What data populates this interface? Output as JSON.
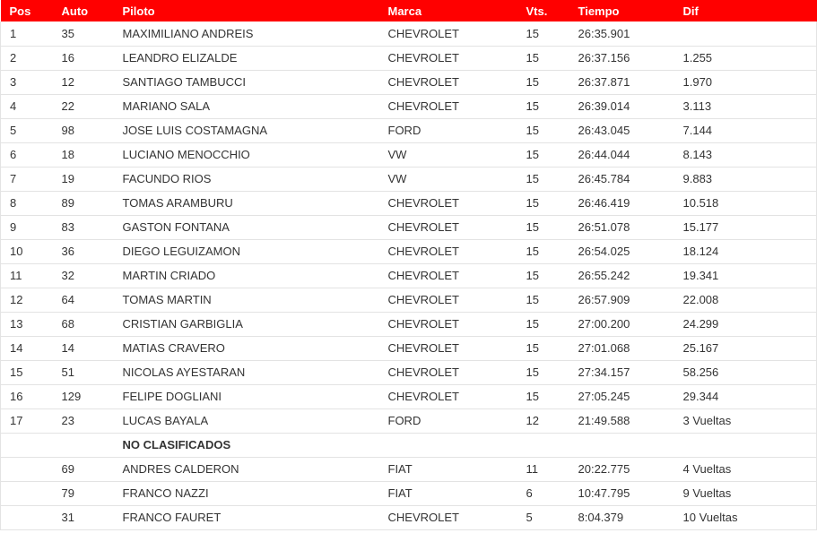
{
  "headers": {
    "pos": "Pos",
    "auto": "Auto",
    "piloto": "Piloto",
    "marca": "Marca",
    "vts": "Vts.",
    "tiempo": "Tiempo",
    "dif": "Dif"
  },
  "colors": {
    "header_bg": "#ff0000",
    "header_text": "#ffffff"
  },
  "classified": [
    {
      "pos": "1",
      "auto": "35",
      "piloto": "MAXIMILIANO ANDREIS",
      "marca": "CHEVROLET",
      "vts": "15",
      "tiempo": "26:35.901",
      "dif": ""
    },
    {
      "pos": "2",
      "auto": "16",
      "piloto": "LEANDRO ELIZALDE",
      "marca": "CHEVROLET",
      "vts": "15",
      "tiempo": "26:37.156",
      "dif": "1.255"
    },
    {
      "pos": "3",
      "auto": "12",
      "piloto": "SANTIAGO TAMBUCCI",
      "marca": "CHEVROLET",
      "vts": "15",
      "tiempo": "26:37.871",
      "dif": "1.970"
    },
    {
      "pos": "4",
      "auto": "22",
      "piloto": "MARIANO SALA",
      "marca": "CHEVROLET",
      "vts": "15",
      "tiempo": "26:39.014",
      "dif": "3.113"
    },
    {
      "pos": "5",
      "auto": "98",
      "piloto": "JOSE LUIS COSTAMAGNA",
      "marca": "FORD",
      "vts": "15",
      "tiempo": "26:43.045",
      "dif": "7.144"
    },
    {
      "pos": "6",
      "auto": "18",
      "piloto": "LUCIANO MENOCCHIO",
      "marca": "VW",
      "vts": "15",
      "tiempo": "26:44.044",
      "dif": "8.143"
    },
    {
      "pos": "7",
      "auto": "19",
      "piloto": "FACUNDO RIOS",
      "marca": "VW",
      "vts": "15",
      "tiempo": "26:45.784",
      "dif": "9.883"
    },
    {
      "pos": "8",
      "auto": "89",
      "piloto": "TOMAS ARAMBURU",
      "marca": "CHEVROLET",
      "vts": "15",
      "tiempo": "26:46.419",
      "dif": "10.518"
    },
    {
      "pos": "9",
      "auto": "83",
      "piloto": "GASTON FONTANA",
      "marca": "CHEVROLET",
      "vts": "15",
      "tiempo": "26:51.078",
      "dif": "15.177"
    },
    {
      "pos": "10",
      "auto": "36",
      "piloto": "DIEGO LEGUIZAMON",
      "marca": "CHEVROLET",
      "vts": "15",
      "tiempo": "26:54.025",
      "dif": "18.124"
    },
    {
      "pos": "11",
      "auto": "32",
      "piloto": "MARTIN CRIADO",
      "marca": "CHEVROLET",
      "vts": "15",
      "tiempo": "26:55.242",
      "dif": "19.341"
    },
    {
      "pos": "12",
      "auto": "64",
      "piloto": "TOMAS MARTIN",
      "marca": "CHEVROLET",
      "vts": "15",
      "tiempo": "26:57.909",
      "dif": "22.008"
    },
    {
      "pos": "13",
      "auto": "68",
      "piloto": "CRISTIAN GARBIGLIA",
      "marca": "CHEVROLET",
      "vts": "15",
      "tiempo": "27:00.200",
      "dif": "24.299"
    },
    {
      "pos": "14",
      "auto": "14",
      "piloto": "MATIAS CRAVERO",
      "marca": "CHEVROLET",
      "vts": "15",
      "tiempo": "27:01.068",
      "dif": "25.167"
    },
    {
      "pos": "15",
      "auto": "51",
      "piloto": "NICOLAS AYESTARAN",
      "marca": "CHEVROLET",
      "vts": "15",
      "tiempo": "27:34.157",
      "dif": "58.256"
    },
    {
      "pos": "16",
      "auto": "129",
      "piloto": "FELIPE DOGLIANI",
      "marca": "CHEVROLET",
      "vts": "15",
      "tiempo": "27:05.245",
      "dif": "29.344"
    },
    {
      "pos": "17",
      "auto": "23",
      "piloto": "LUCAS BAYALA",
      "marca": "FORD",
      "vts": "12",
      "tiempo": "21:49.588",
      "dif": "3 Vueltas"
    }
  ],
  "unclassified_label": "NO CLASIFICADOS",
  "unclassified": [
    {
      "pos": "",
      "auto": "69",
      "piloto": "ANDRES CALDERON",
      "marca": "FIAT",
      "vts": "11",
      "tiempo": "20:22.775",
      "dif": "4 Vueltas"
    },
    {
      "pos": "",
      "auto": "79",
      "piloto": "FRANCO NAZZI",
      "marca": "FIAT",
      "vts": "6",
      "tiempo": "10:47.795",
      "dif": "9 Vueltas"
    },
    {
      "pos": "",
      "auto": "31",
      "piloto": "FRANCO FAURET",
      "marca": "CHEVROLET",
      "vts": "5",
      "tiempo": "8:04.379",
      "dif": "10 Vueltas"
    }
  ]
}
